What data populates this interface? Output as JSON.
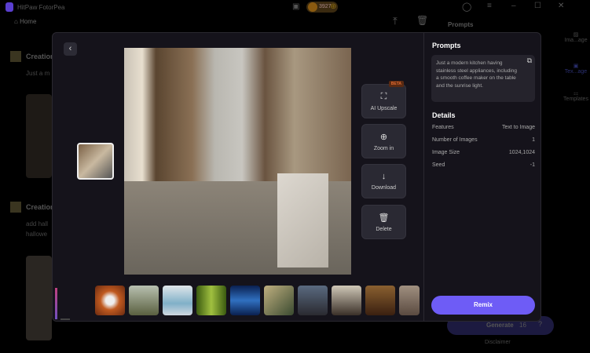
{
  "app": {
    "title": "HitPaw FotorPea",
    "credits": "3927"
  },
  "nav": {
    "home": "Home"
  },
  "background": {
    "prompts_title": "Prompts",
    "creations": [
      {
        "title": "Creation",
        "text": "Just a m"
      },
      {
        "title": "Creation",
        "text": "add hall",
        "text2": "hallowe"
      }
    ],
    "generate_label": "Generate",
    "generate_cost": "16",
    "disclaimer": "Disclaimer",
    "sidebar": [
      "Ima...age",
      "Tex...age",
      "Templates"
    ]
  },
  "viewer": {
    "actions": [
      {
        "label": "AI Upscale",
        "badge": "BETA"
      },
      {
        "label": "Zoom in"
      },
      {
        "label": "Download"
      },
      {
        "label": "Delete"
      }
    ]
  },
  "panel": {
    "prompts_title": "Prompts",
    "prompt_text": "Just a modern kitchen having stainless steel appliances, including a smooth coffee maker on the table and the sunrise light.",
    "details_title": "Details",
    "details": [
      {
        "k": "Features",
        "v": "Text to Image"
      },
      {
        "k": "Number of Images",
        "v": "1"
      },
      {
        "k": "Image Size",
        "v": "1024,1024"
      },
      {
        "k": "Seed",
        "v": "-1"
      }
    ],
    "remix_label": "Remix"
  },
  "colors": {
    "accent": "#6e5cf6",
    "modal_bg": "#15131b"
  }
}
